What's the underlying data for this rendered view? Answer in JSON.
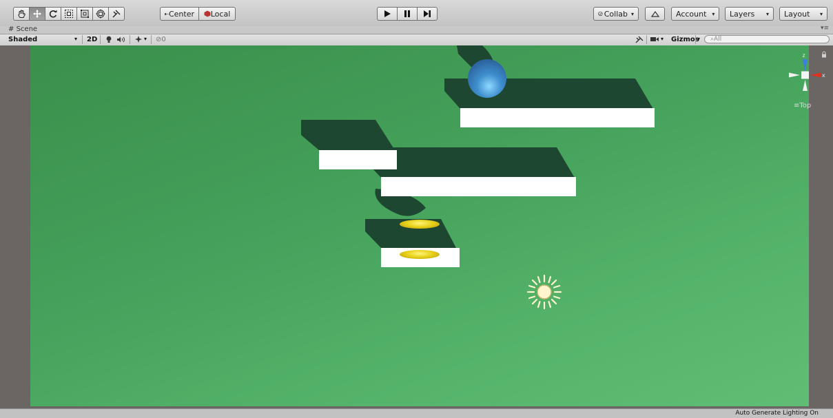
{
  "toolbar": {
    "tools": [
      {
        "name": "hand-tool-icon"
      },
      {
        "name": "move-tool-icon",
        "active": true
      },
      {
        "name": "rotate-tool-icon"
      },
      {
        "name": "scale-tool-icon"
      },
      {
        "name": "rect-tool-icon"
      },
      {
        "name": "transform-tool-icon"
      },
      {
        "name": "custom-tool-icon"
      }
    ],
    "pivot_label": "Center",
    "space_label": "Local",
    "collab_label": "Collab",
    "account_label": "Account",
    "layers_label": "Layers",
    "layout_label": "Layout"
  },
  "scene_tab": {
    "label": "Scene"
  },
  "scene_toolbar": {
    "draw_mode": "Shaded",
    "mode_2d": "2D",
    "hidden_count": "0",
    "gizmos_label": "Gizmos",
    "search_placeholder": "All"
  },
  "viewport": {
    "orientation_label": "Top",
    "axis_labels": {
      "z": "z",
      "x": "x"
    }
  },
  "status": {
    "text": "Auto Generate Lighting On"
  },
  "colors": {
    "ground": "#44a05a",
    "shadow": "#1d4730",
    "platform": "#ffffff",
    "ball": "#3f8fce",
    "coin": "#e8d21b",
    "x_axis": "#e0311f",
    "z_axis": "#3d7ee0"
  }
}
